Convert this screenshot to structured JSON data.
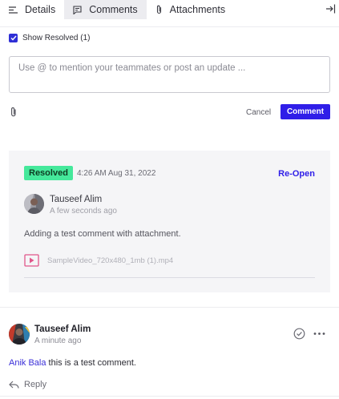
{
  "tabs": [
    {
      "label": "Details",
      "icon": "list-icon"
    },
    {
      "label": "Comments",
      "icon": "comment-icon",
      "active": true
    },
    {
      "label": "Attachments",
      "icon": "paperclip-icon"
    }
  ],
  "filter": {
    "show_resolved_label": "Show Resolved (1)",
    "checked": true
  },
  "composer": {
    "placeholder": "Use @ to mention your teammates or post an update ...",
    "cancel_label": "Cancel",
    "submit_label": "Comment"
  },
  "resolved_thread": {
    "badge": "Resolved",
    "resolved_at": "4:26 AM Aug 31, 2022",
    "reopen_label": "Re-Open",
    "author": "Tauseef Alim",
    "time_ago": "A few seconds ago",
    "body": "Adding a test comment with attachment.",
    "attachment_name": "SampleVideo_720x480_1mb (1).mp4"
  },
  "comment": {
    "author": "Tauseef Alim",
    "time_ago": "A minute ago",
    "mention": "Anik Bala",
    "body": " this is a test comment.",
    "reply_label": "Reply"
  },
  "colors": {
    "accent": "#2f1ee8",
    "resolved_badge": "#45e89b",
    "attachment_icon": "#e0568a"
  }
}
